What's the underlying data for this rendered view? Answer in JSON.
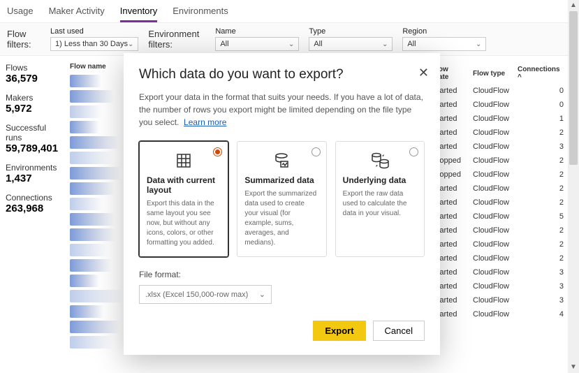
{
  "tabs": [
    "Usage",
    "Maker Activity",
    "Inventory",
    "Environments"
  ],
  "tabs_active_index": 2,
  "flow_filters": {
    "title": "Flow filters:",
    "last_used_label": "Last used",
    "last_used_value": "1) Less than 30 Days"
  },
  "env_filters": {
    "title": "Environment filters:",
    "name_label": "Name",
    "name_value": "All",
    "type_label": "Type",
    "type_value": "All",
    "region_label": "Region",
    "region_value": "All"
  },
  "stats": [
    {
      "label": "Flows",
      "value": "36,579"
    },
    {
      "label": "Makers",
      "value": "5,972"
    },
    {
      "label": "Successful runs",
      "value": "59,789,401"
    },
    {
      "label": "Environments",
      "value": "1,437"
    },
    {
      "label": "Connections",
      "value": "263,968"
    }
  ],
  "flow_name_header": "Flow name",
  "table": {
    "headers": {
      "state": "Flow state",
      "type": "Flow type",
      "conn": "Connections ^"
    },
    "rows": [
      {
        "id": "37510",
        "state": "Started",
        "type": "CloudFlow",
        "conn": 0
      },
      {
        "id": "5592fe",
        "state": "Started",
        "type": "CloudFlow",
        "conn": 0
      },
      {
        "id": "1e222",
        "state": "Started",
        "type": "CloudFlow",
        "conn": 1
      },
      {
        "id": "ea36e",
        "state": "Started",
        "type": "CloudFlow",
        "conn": 2
      },
      {
        "id": "6cb88",
        "state": "Started",
        "type": "CloudFlow",
        "conn": 3
      },
      {
        "id": "dc36bb",
        "state": "Stopped",
        "type": "CloudFlow",
        "conn": 2
      },
      {
        "id": "c4e80",
        "state": "Stopped",
        "type": "CloudFlow",
        "conn": 2
      },
      {
        "id": "fc04f1",
        "state": "Started",
        "type": "CloudFlow",
        "conn": 2
      },
      {
        "id": "d9390",
        "state": "Started",
        "type": "CloudFlow",
        "conn": 2
      },
      {
        "id": "ac028c",
        "state": "Started",
        "type": "CloudFlow",
        "conn": 5
      },
      {
        "id": "20c1",
        "state": "Started",
        "type": "CloudFlow",
        "conn": 2
      },
      {
        "id": "9cc9d",
        "state": "Started",
        "type": "CloudFlow",
        "conn": 2
      },
      {
        "id": "34e175",
        "state": "Started",
        "type": "CloudFlow",
        "conn": 2
      },
      {
        "id": "eb5a0",
        "state": "Started",
        "type": "CloudFlow",
        "conn": 3
      },
      {
        "id": "b71d5d",
        "state": "Started",
        "type": "CloudFlow",
        "conn": 3
      },
      {
        "id": "ca9d5",
        "state": "Started",
        "type": "CloudFlow",
        "conn": 3
      },
      {
        "id": "2e1ff",
        "state": "Started",
        "type": "CloudFlow",
        "conn": 4
      }
    ]
  },
  "modal": {
    "title": "Which data do you want to export?",
    "desc": "Export your data in the format that suits your needs. If you have a lot of data, the number of rows you export might be limited depending on the file type you select.",
    "learn_more": "Learn more",
    "options": [
      {
        "title": "Data with current layout",
        "sub": "Export this data in the same layout you see now, but without any icons, colors, or other formatting you added."
      },
      {
        "title": "Summarized data",
        "sub": "Export the summarized data used to create your visual (for example, sums, averages, and medians)."
      },
      {
        "title": "Underlying data",
        "sub": "Export the raw data used to calculate the data in your visual."
      }
    ],
    "selected_option_index": 0,
    "file_format_label": "File format:",
    "file_format_value": ".xlsx (Excel 150,000-row max)",
    "export_label": "Export",
    "cancel_label": "Cancel"
  }
}
